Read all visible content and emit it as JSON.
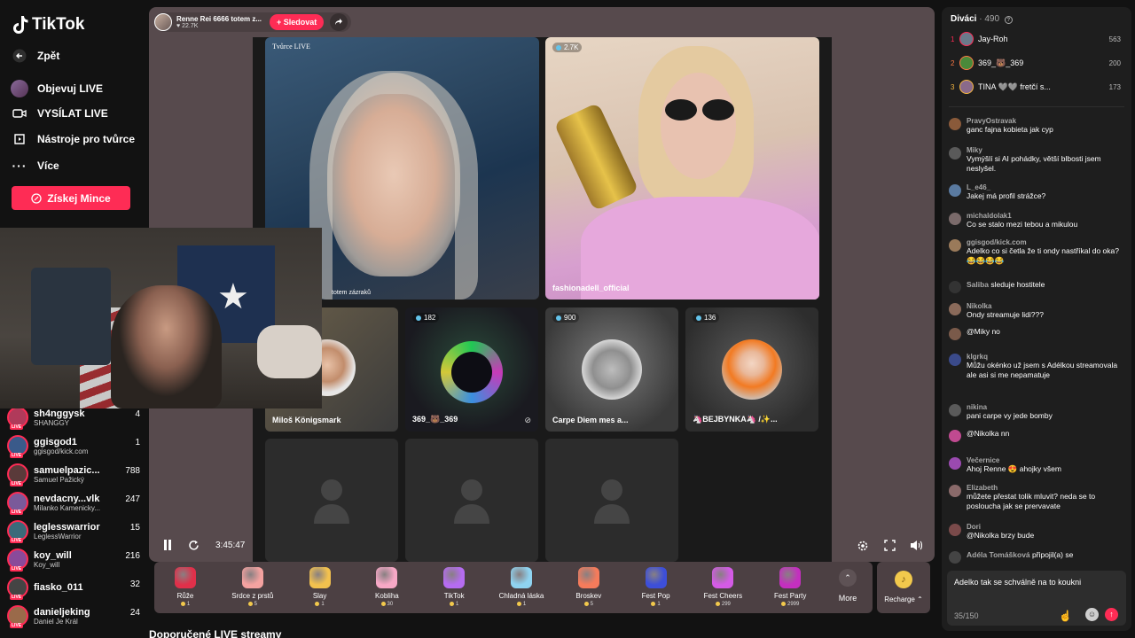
{
  "app": {
    "brand": "TikTok"
  },
  "nav": {
    "back": "Zpět",
    "explore": "Objevuj LIVE",
    "golive": "VYSÍLAT LIVE",
    "tools": "Nástroje pro tvůrce",
    "more": "Více",
    "coins_btn": "Získej Mince"
  },
  "live_list": [
    {
      "name": "sh4nggysk",
      "sub": "SHANGGY",
      "count": "4"
    },
    {
      "name": "ggisgod1",
      "sub": "ggisgod/kick.com",
      "count": "1"
    },
    {
      "name": "samuelpazic...",
      "sub": "Samuel Pažický",
      "count": "788"
    },
    {
      "name": "nevdacny...vlk",
      "sub": "Milanko Kamenicky...",
      "count": "247"
    },
    {
      "name": "leglesswarrior",
      "sub": "LeglessWarrior",
      "count": "15"
    },
    {
      "name": "koy_will",
      "sub": "Koy_will",
      "count": "216"
    },
    {
      "name": "fiasko_011",
      "sub": "",
      "count": "32"
    },
    {
      "name": "danieljeking",
      "sub": "Daniel Je Král",
      "count": "24"
    }
  ],
  "live_tag": "LIVE",
  "host": {
    "name": "Renne Rei 6666 totem z...",
    "viewers": "22.7K",
    "follow": "+ Sledovat"
  },
  "tiles": {
    "host_label": "Tvůrce LIVE",
    "host_caption": "totem zázraků",
    "guest1_count": "2.7K",
    "guest1_name": "fashionadell_official",
    "t1_name": "Miloš Königsmark",
    "t2_count": "182",
    "t2_name": "369_🐻_369",
    "t3_count": "900",
    "t3_name": "Carpe Diem mes a...",
    "t4_count": "136",
    "t4_name": "🦄BEJBYNKA🦄 /✨..."
  },
  "player": {
    "time": "3:45:47"
  },
  "gifts": [
    {
      "name": "Růže",
      "price": "1",
      "color": "#e0304a"
    },
    {
      "name": "Srdce z prstů",
      "price": "5",
      "color": "#f4a2a0"
    },
    {
      "name": "Slay",
      "price": "1",
      "color": "#f2c14e"
    },
    {
      "name": "Kobliha",
      "price": "30",
      "color": "#f7a8c6"
    },
    {
      "name": "TikTok",
      "price": "1",
      "color": "#b56cf0"
    },
    {
      "name": "Chladná láska",
      "price": "1",
      "color": "#8fd3f0"
    },
    {
      "name": "Broskev",
      "price": "5",
      "color": "#f57b5b"
    },
    {
      "name": "Fest Pop",
      "price": "1",
      "color": "#3d4fd9"
    },
    {
      "name": "Fest Cheers",
      "price": "299",
      "color": "#d45be6"
    },
    {
      "name": "Fest Party",
      "price": "2999",
      "color": "#c42fbf"
    }
  ],
  "gift_more": "More",
  "recharge": "Recharge",
  "recommend": "Doporučené LIVE streamy",
  "chat": {
    "viewers_label": "Diváci",
    "viewers_count": "490",
    "top": [
      {
        "rank": "1",
        "name": "Jay-Roh",
        "count": "563",
        "color": "#fe2c55"
      },
      {
        "rank": "2",
        "name": "369_🐻_369",
        "count": "200",
        "color": "#ff7a45"
      },
      {
        "rank": "3",
        "name": "TINA 🩶🩶 fretčí s...",
        "count": "173",
        "color": "#f5b642"
      }
    ],
    "messages": [
      {
        "name": "PravyOstravak",
        "text": "ganc fajna kobieta jak cyp"
      },
      {
        "name": "Miky",
        "text": "Vymýšlí si AI pohádky, větší blbosti jsem neslyšel."
      },
      {
        "name": "L_e46_",
        "text": "Jakej má profil strážce?"
      },
      {
        "name": "michaldolak1",
        "text": "Co se stalo mezi tebou a mikulou"
      },
      {
        "name": "ggisgod/kick.com",
        "text": "Adelko co si četla že ti ondy nastříkal do oka? 😂😂😂😂"
      },
      {
        "name": "Saliba",
        "text": "sleduje hostitele"
      },
      {
        "name": "Nikolka",
        "text": "Ondy streamuje lidi???"
      },
      {
        "name": "",
        "text": "@Miky no"
      },
      {
        "name": "klgrkq",
        "text": "Můžu okénko už jsem s Adélkou streamovala ale asi si me nepamatuje"
      },
      {
        "name": "nikina",
        "text": "pani carpe vy jede bomby"
      },
      {
        "name": "",
        "text": "@Nikolka nn"
      },
      {
        "name": "Večernice",
        "text": "Ahoj Renne 😍 ahojky všem"
      },
      {
        "name": "Elizabeth",
        "text": "můžete přestat tolik mluvit? neda se to posloucha jak se prervavate"
      },
      {
        "name": "Dori",
        "text": "@Nikolka brzy bude"
      },
      {
        "name": "Adéla Tomášková",
        "text": "připojil(a) se"
      }
    ],
    "input_value": "Adelko tak se schválně na to koukni",
    "char_count": "35/150"
  }
}
